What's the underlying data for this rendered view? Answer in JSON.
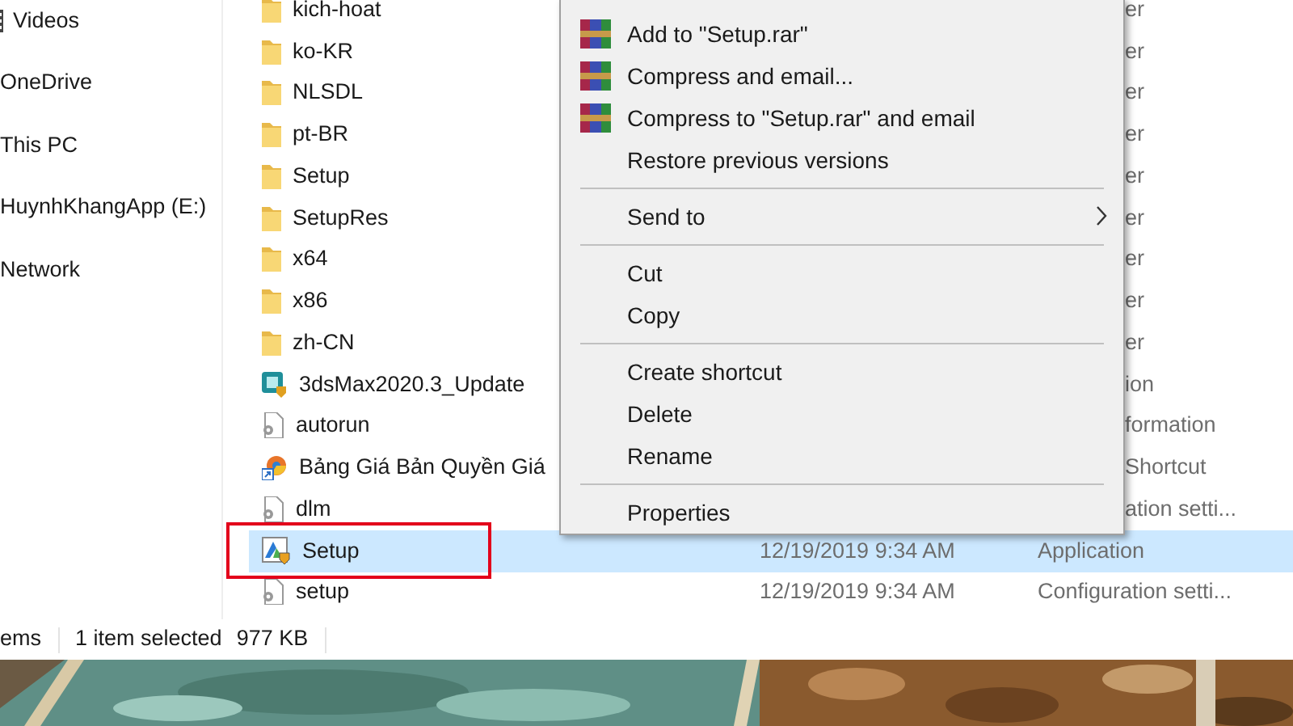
{
  "nav_pane": {
    "items": [
      {
        "label": "Videos",
        "kind": "videos"
      },
      {
        "label": "OneDrive",
        "kind": "plain"
      },
      {
        "label": "This PC",
        "kind": "plain"
      },
      {
        "label": "HuynhKhangApp (E:)",
        "kind": "plain"
      },
      {
        "label": "Network",
        "kind": "plain"
      }
    ]
  },
  "files": [
    {
      "name": "kich-hoat",
      "kind": "folder",
      "type": "er",
      "selected": false
    },
    {
      "name": "ko-KR",
      "kind": "folder",
      "type": "er",
      "selected": false
    },
    {
      "name": "NLSDL",
      "kind": "folder",
      "type": "er",
      "selected": false
    },
    {
      "name": "pt-BR",
      "kind": "folder",
      "type": "er",
      "selected": false
    },
    {
      "name": "Setup",
      "kind": "folder",
      "type": "er",
      "selected": false
    },
    {
      "name": "SetupRes",
      "kind": "folder",
      "type": "er",
      "selected": false
    },
    {
      "name": "x64",
      "kind": "folder",
      "type": "er",
      "selected": false
    },
    {
      "name": "x86",
      "kind": "folder",
      "type": "er",
      "selected": false
    },
    {
      "name": "zh-CN",
      "kind": "folder",
      "type": "er",
      "selected": false
    },
    {
      "name": "3dsMax2020.3_Update",
      "kind": "package",
      "type": "ion",
      "selected": false
    },
    {
      "name": "autorun",
      "kind": "settings-file",
      "type": "formation",
      "selected": false
    },
    {
      "name": "Bảng Giá Bản Quyền Giá",
      "kind": "shortcut",
      "type": "Shortcut",
      "selected": false
    },
    {
      "name": "dlm",
      "kind": "settings-file",
      "type": "ation setti...",
      "selected": false
    },
    {
      "name": "Setup",
      "kind": "installer",
      "date": "12/19/2019 9:34 AM",
      "type": "Application",
      "selected": true
    },
    {
      "name": "setup",
      "kind": "settings-file",
      "date": "12/19/2019 9:34 AM",
      "type": "Configuration setti...",
      "selected": false
    }
  ],
  "context_menu": {
    "items": [
      {
        "kind": "archive",
        "label": "Add to \"Setup.rar\""
      },
      {
        "kind": "archive",
        "label": "Compress and email..."
      },
      {
        "kind": "archive",
        "label": "Compress to \"Setup.rar\" and email"
      },
      {
        "kind": "plain",
        "label": "Restore previous versions"
      },
      {
        "kind": "separator"
      },
      {
        "kind": "submenu",
        "label": "Send to"
      },
      {
        "kind": "separator"
      },
      {
        "kind": "plain",
        "label": "Cut"
      },
      {
        "kind": "plain",
        "label": "Copy"
      },
      {
        "kind": "separator"
      },
      {
        "kind": "plain",
        "label": "Create shortcut"
      },
      {
        "kind": "plain",
        "label": "Delete"
      },
      {
        "kind": "plain",
        "label": "Rename"
      },
      {
        "kind": "separator"
      },
      {
        "kind": "plain",
        "label": "Properties"
      }
    ]
  },
  "status_bar": {
    "count": "ems",
    "selection": "1 item selected",
    "size": "977 KB"
  }
}
